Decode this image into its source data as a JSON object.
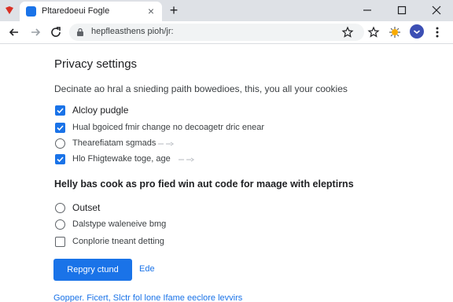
{
  "browser": {
    "tab_title": "Pltaredoeui Fogle",
    "url": "hepfleasthens pioh/jr:",
    "new_tab": "+",
    "tab_close": "×",
    "accent_color": "#1a73e8"
  },
  "page": {
    "heading": "Privacy settings",
    "description": "Decinate ao hral a snieding paith bowedioes, this, you all your cookies",
    "options": [
      {
        "label": "Alcloy pudgle",
        "checked": true,
        "emphasis": true
      },
      {
        "label": "Hual bgoiced fmir change no decoagetr dric enear",
        "checked": true
      },
      {
        "label": "Thearefiatam sgmads",
        "checked": false,
        "type": "radio"
      },
      {
        "label": "Hlo Fhigtewake toge, age",
        "checked": true
      }
    ],
    "section_heading": "Helly bas cook as pro fied win aut code for maage with eleptirns",
    "choices": [
      {
        "label": "Outset",
        "type": "radio",
        "emphasis": true
      },
      {
        "label": "Dalstype waleneive bmg",
        "type": "radio"
      },
      {
        "label": "Conplorie tneant detting",
        "type": "checkbox"
      }
    ],
    "primary_button": "Repgry ctund",
    "secondary_button": "Ede",
    "footer_link": "Gopper. Ficert, Slctr fol lone Ifame eeclore levvirs"
  }
}
